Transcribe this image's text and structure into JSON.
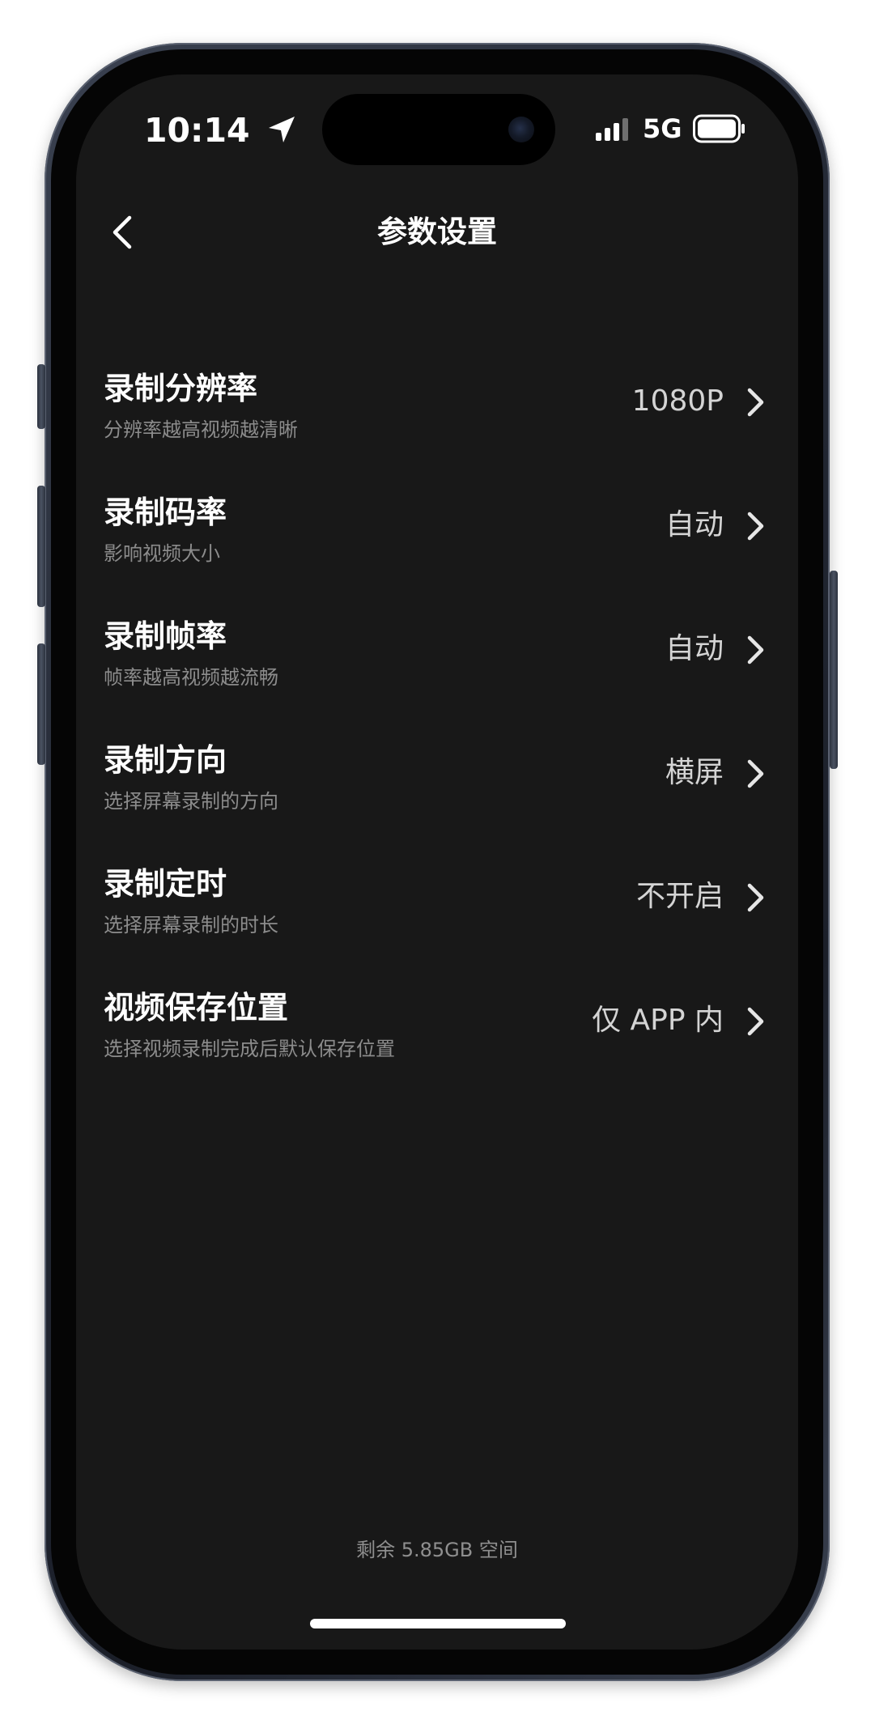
{
  "status_bar": {
    "time": "10:14",
    "network": "5G",
    "icons": [
      "location-arrow-icon",
      "cellular-signal-icon",
      "battery-icon"
    ]
  },
  "nav": {
    "back_icon": "chevron-left-icon",
    "title": "参数设置"
  },
  "settings": {
    "items": [
      {
        "title": "录制分辨率",
        "subtitle": "分辨率越高视频越清晰",
        "value": "1080P"
      },
      {
        "title": "录制码率",
        "subtitle": "影响视频大小",
        "value": "自动"
      },
      {
        "title": "录制帧率",
        "subtitle": "帧率越高视频越流畅",
        "value": "自动"
      },
      {
        "title": "录制方向",
        "subtitle": "选择屏幕录制的方向",
        "value": "横屏"
      },
      {
        "title": "录制定时",
        "subtitle": "选择屏幕录制的时长",
        "value": "不开启"
      },
      {
        "title": "视频保存位置",
        "subtitle": "选择视频录制完成后默认保存位置",
        "value": "仅 APP 内"
      }
    ],
    "chevron_icon": "chevron-right-icon"
  },
  "footer": {
    "storage": "剩余 5.85GB 空间"
  },
  "colors": {
    "background": "#181818",
    "title_text": "#ffffff",
    "subtitle_text": "#8c8c8c",
    "value_text": "#d4d4d4"
  }
}
